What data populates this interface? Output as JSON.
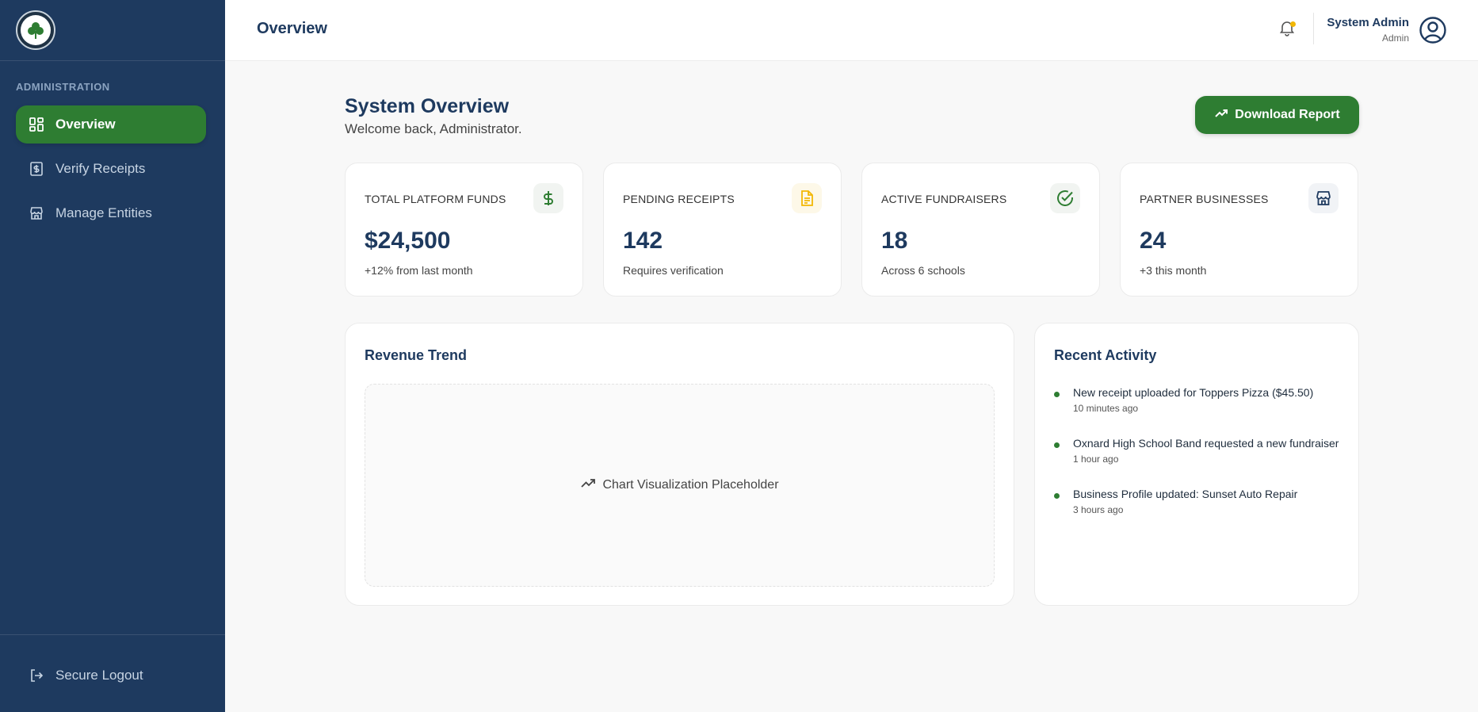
{
  "sidebar": {
    "section_label": "ADMINISTRATION",
    "items": [
      {
        "label": "Overview",
        "icon": "dashboard-grid-icon",
        "active": true
      },
      {
        "label": "Verify Receipts",
        "icon": "receipt-icon",
        "active": false
      },
      {
        "label": "Manage Entities",
        "icon": "storefront-icon",
        "active": false
      }
    ],
    "logout_label": "Secure Logout"
  },
  "header": {
    "title": "Overview",
    "user_name": "System Admin",
    "user_role": "Admin",
    "notification_dot_color": "#f2b705"
  },
  "main": {
    "title": "System Overview",
    "subtitle": "Welcome back, Administrator.",
    "download_label": "Download Report"
  },
  "stats": [
    {
      "label": "TOTAL PLATFORM FUNDS",
      "value": "$24,500",
      "note": "+12% from last month",
      "icon": "dollar-icon",
      "icon_color": "#2e7d32"
    },
    {
      "label": "PENDING RECEIPTS",
      "value": "142",
      "note": "Requires verification",
      "icon": "document-icon",
      "icon_color": "#f2b705"
    },
    {
      "label": "ACTIVE FUNDRAISERS",
      "value": "18",
      "note": "Across 6 schools",
      "icon": "check-circle-icon",
      "icon_color": "#2e7d32"
    },
    {
      "label": "PARTNER BUSINESSES",
      "value": "24",
      "note": "+3 this month",
      "icon": "storefront-icon",
      "icon_color": "#1e3a5f"
    }
  ],
  "revenue": {
    "title": "Revenue Trend",
    "placeholder": "Chart Visualization Placeholder"
  },
  "activity": {
    "title": "Recent Activity",
    "items": [
      {
        "text": "New receipt uploaded for Toppers Pizza ($45.50)",
        "time": "10 minutes ago"
      },
      {
        "text": "Oxnard High School Band requested a new fundraiser",
        "time": "1 hour ago"
      },
      {
        "text": "Business Profile updated: Sunset Auto Repair",
        "time": "3 hours ago"
      }
    ]
  },
  "colors": {
    "sidebar_bg": "#1e3a5f",
    "accent_green": "#2e7d32",
    "page_bg": "#f8f8f8"
  }
}
